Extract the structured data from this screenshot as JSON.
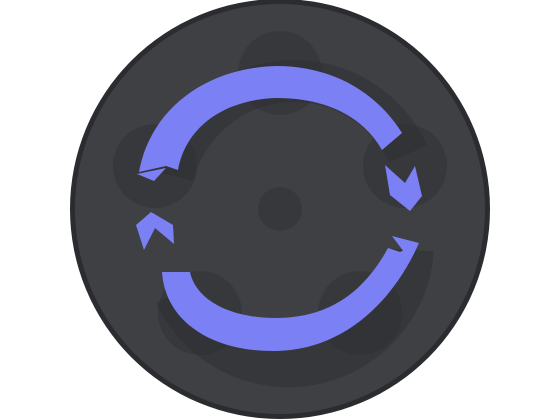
{
  "icon": {
    "name": "refresh-sync-icon",
    "colors": {
      "background": "#ffffff",
      "disc_outer": "#2b2c2f",
      "disc_face": "#3f4044",
      "shadow_dot": "#37383c",
      "arrow": "#7b80f4",
      "arrow_shadow": "#2f3034"
    }
  }
}
